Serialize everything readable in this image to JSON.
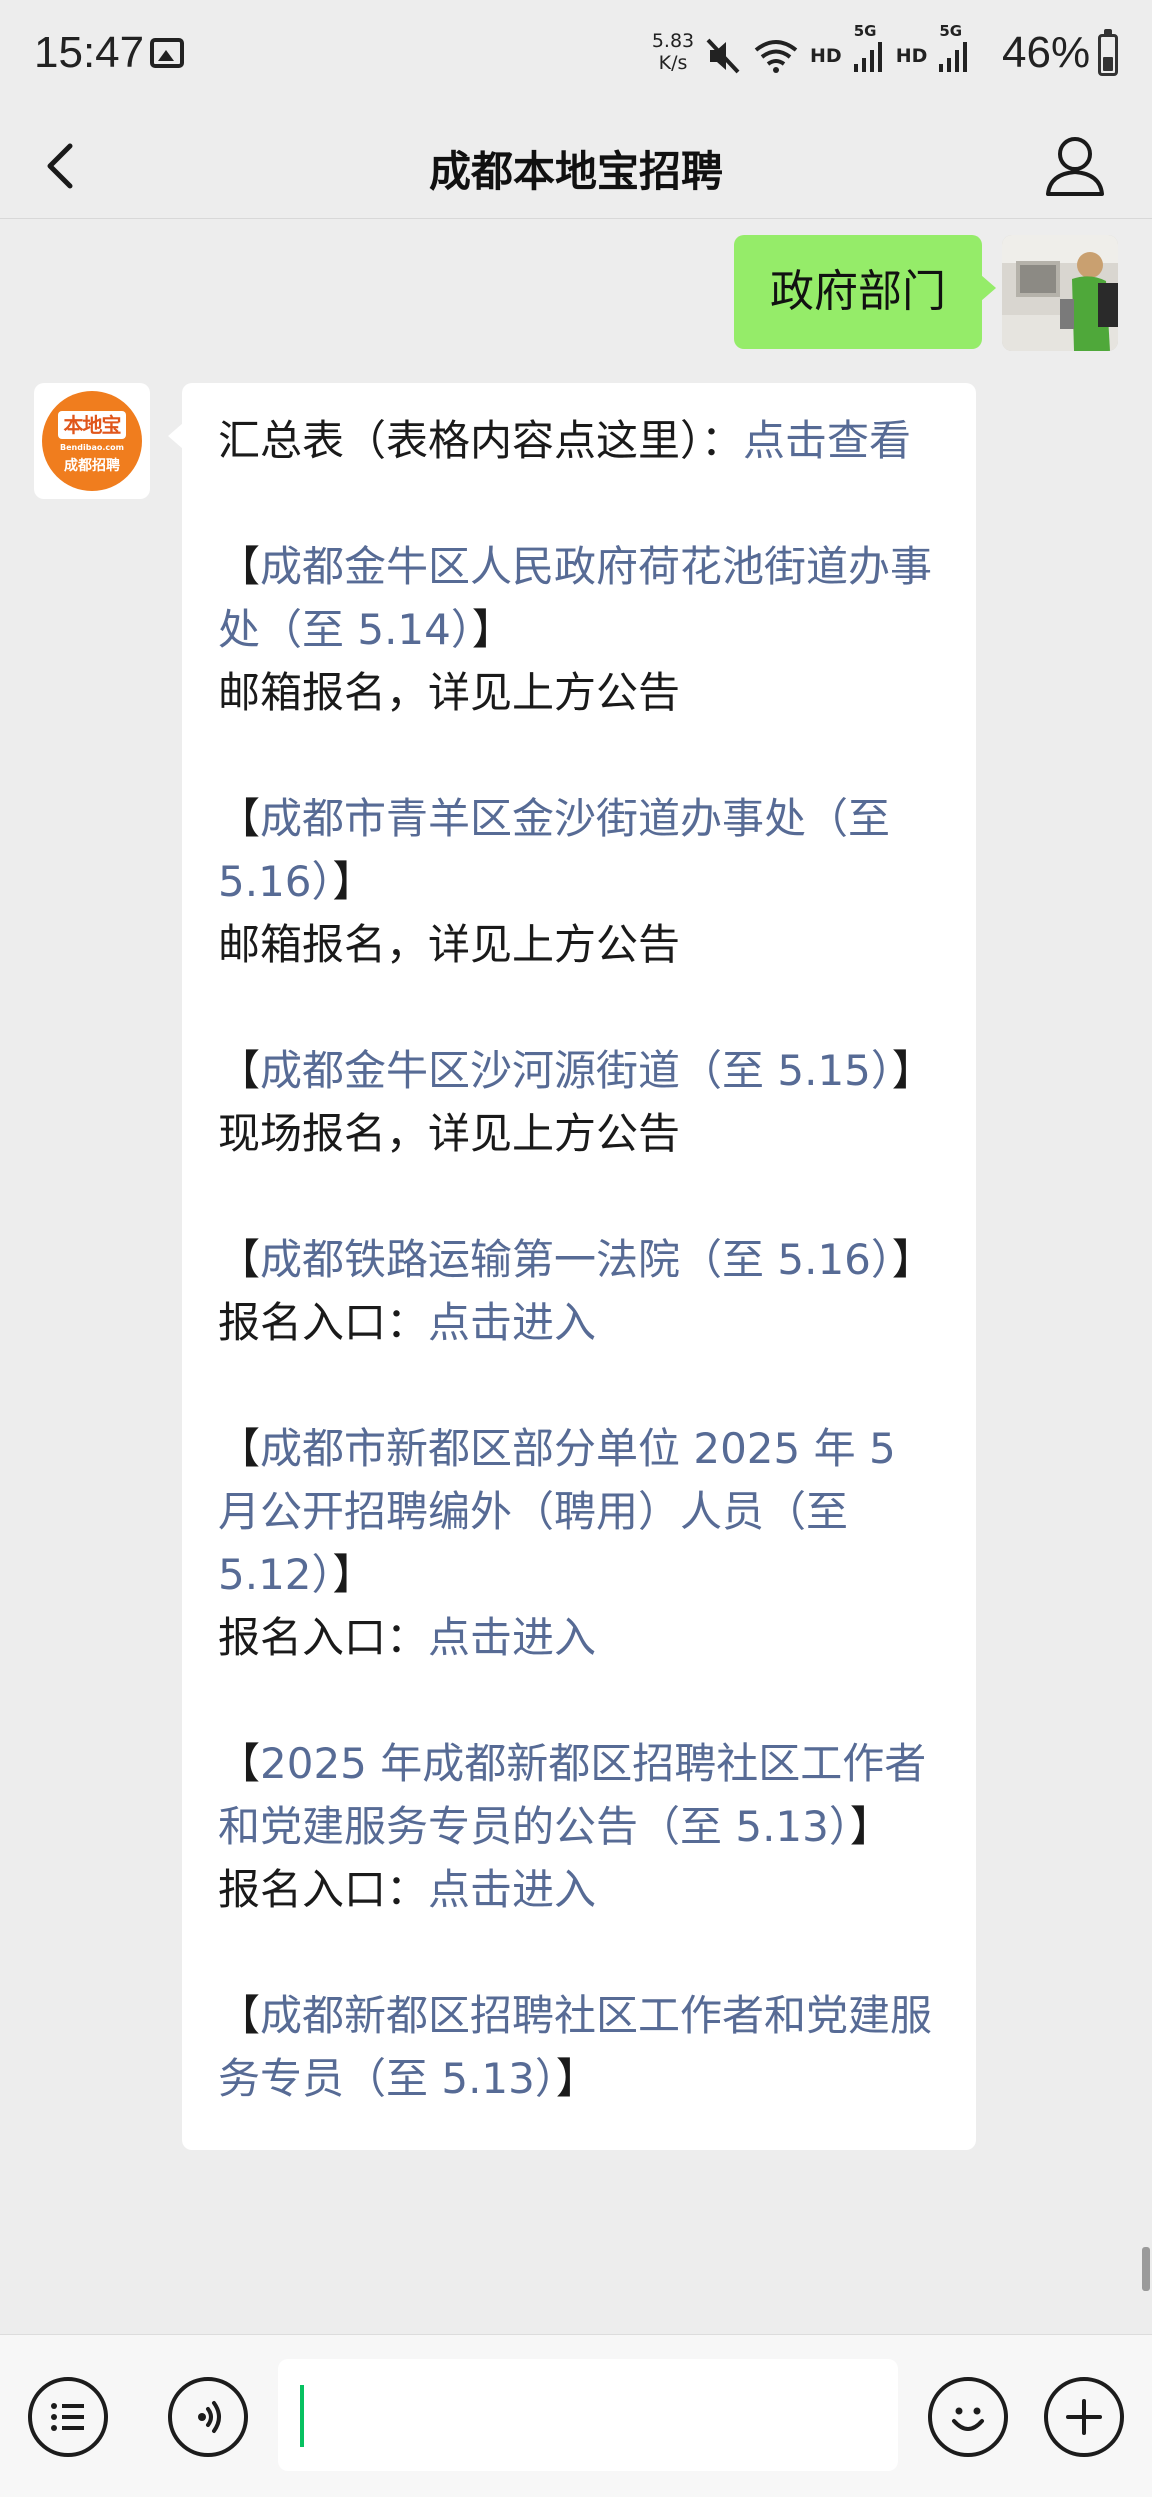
{
  "status_bar": {
    "time": "15:47",
    "speed_value": "5.83",
    "speed_unit": "K/s",
    "hd1": "HD",
    "net1": "5G",
    "hd2": "HD",
    "net2": "5G",
    "battery": "46%"
  },
  "nav": {
    "title": "成都本地宝招聘"
  },
  "chat": {
    "outgoing": {
      "text": "政府部门"
    },
    "bot_logo": {
      "top": "本地宝",
      "url": "Bendibao.com",
      "bottom": "成都招聘"
    },
    "summary": {
      "text": "汇总表（表格内容点这里）：",
      "link": "点击查看"
    },
    "items": [
      {
        "open": "【",
        "title": "成都金牛区人民政府荷花池街道办事处（至 5.14）",
        "close": "】",
        "prefix": "邮箱报名，详见上方公告",
        "link": ""
      },
      {
        "open": "【",
        "title": "成都市青羊区金沙街道办事处（至 5.16）",
        "close": "】",
        "prefix": "邮箱报名，详见上方公告",
        "link": ""
      },
      {
        "open": "【",
        "title": "成都金牛区沙河源街道（至 5.15）",
        "close": "】",
        "prefix": "现场报名，详见上方公告",
        "link": ""
      },
      {
        "open": "【",
        "title": "成都铁路运输第一法院（至 5.16）",
        "close": "】",
        "prefix": "报名入口：",
        "link": "点击进入"
      },
      {
        "open": "【",
        "title": "成都市新都区部分单位 2025 年 5 月公开招聘编外（聘用）人员（至 5.12）",
        "close": "】",
        "prefix": "报名入口：",
        "link": "点击进入"
      },
      {
        "open": "【",
        "title": "2025 年成都新都区招聘社区工作者和党建服务专员的公告（至 5.13）",
        "close": "】",
        "prefix": "报名入口：",
        "link": "点击进入"
      },
      {
        "open": "【",
        "title": "成都新都区招聘社区工作者和党建服务专员（至 5.13）",
        "close": "】",
        "prefix": "",
        "link": ""
      }
    ]
  },
  "input_bar": {
    "menu_icon": "list-icon",
    "voice_icon": "voice-icon",
    "emoji_icon": "emoji-icon",
    "plus_icon": "plus-icon",
    "input_value": ""
  }
}
